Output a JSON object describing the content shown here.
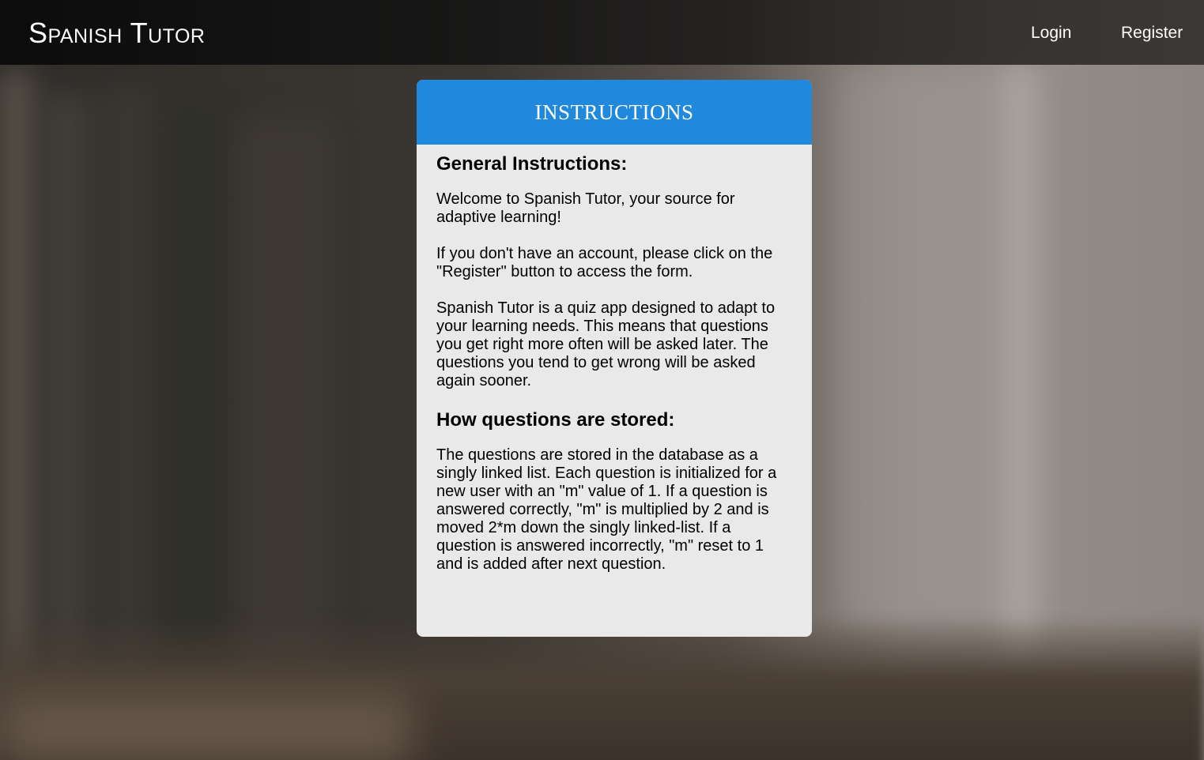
{
  "navbar": {
    "brand": "Spanish Tutor",
    "login_label": "Login",
    "register_label": "Register"
  },
  "card": {
    "title": "INSTRUCTIONS",
    "sections": [
      {
        "heading": "General Instructions:",
        "paragraphs": [
          "Welcome to Spanish Tutor, your source for adaptive learning!",
          "If you don't have an account, please click on the \"Register\" button to access the form.",
          "Spanish Tutor is a quiz app designed to adapt to your learning needs. This means that questions you get right more often will be asked later. The questions you tend to get wrong will be asked again sooner."
        ]
      },
      {
        "heading": "How questions are stored:",
        "paragraphs": [
          "The questions are stored in the database as a singly linked list. Each question is initialized for a new user with an \"m\" value of 1. If a question is answered correctly, \"m\" is multiplied by 2 and is moved 2*m down the singly linked-list. If a question is answered incorrectly, \"m\" reset to 1 and is added after next question."
        ]
      }
    ]
  },
  "colors": {
    "header_blue": "#2089de",
    "card_bg": "#e9e9e9",
    "navbar_bg": "#111111"
  }
}
